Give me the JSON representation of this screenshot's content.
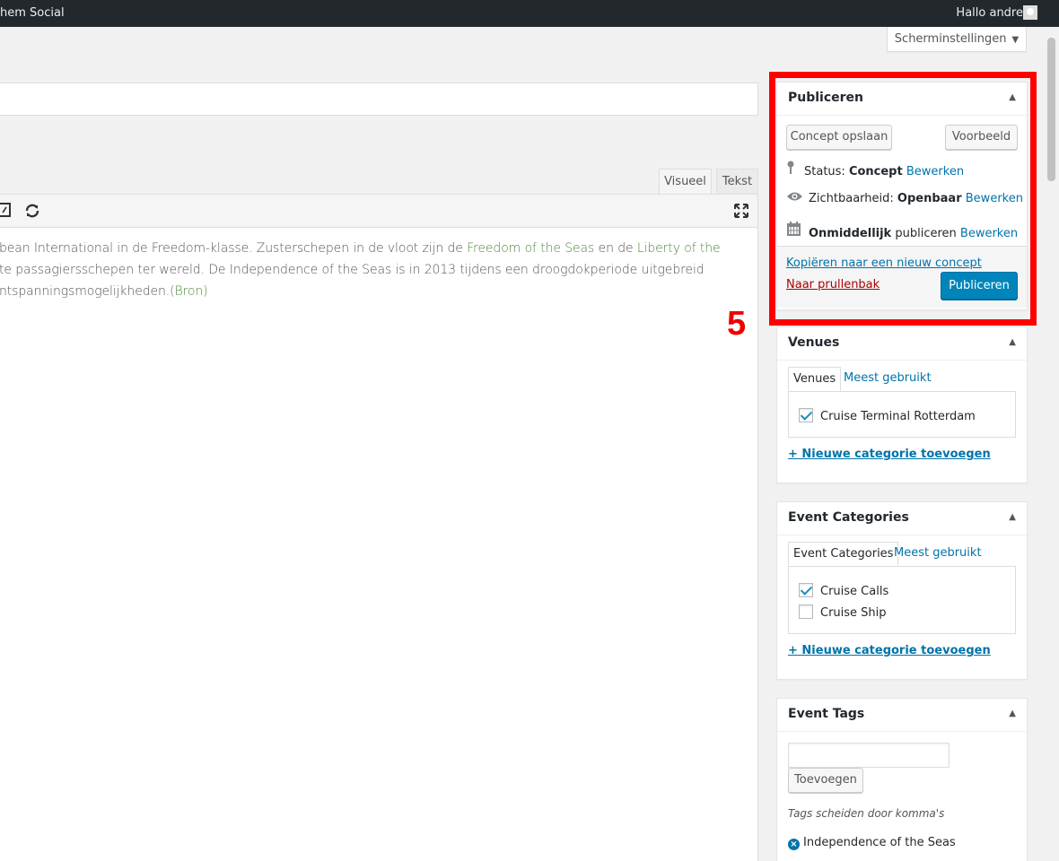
{
  "admin_bar": {
    "site_name": "hem Social",
    "greeting": "Hallo andre"
  },
  "screen_options": {
    "label": "Scherminstellingen",
    "arrow": "▼"
  },
  "editor": {
    "tabs": {
      "visual": "Visueel",
      "text": "Tekst"
    },
    "icons": [
      "code-icon",
      "refresh-icon",
      "fullscreen-icon"
    ],
    "content": {
      "line1_a": "bean International in de Freedom-klasse. Zusterschepen in de vloot zijn de ",
      "line1_link": "Freedom of the Seas",
      "line1_b": " en de ",
      "line1_link2": "Liberty of the",
      "line2": "te passagiersschepen ter wereld. De Independence of the Seas is in 2013 tijdens een droogdokperiode uitgebreid",
      "line3_a": "ntspanningsmogelijkheden.",
      "line3_link": "(Bron)"
    }
  },
  "annotation": {
    "step_number": "5",
    "highlight_color": "#ff0000"
  },
  "publish_box": {
    "title": "Publiceren",
    "save_draft": "Concept opslaan",
    "preview": "Voorbeeld",
    "status_label": "Status: ",
    "status_value": "Concept",
    "visibility_label": "Zichtbaarheid: ",
    "visibility_value": "Openbaar",
    "schedule_value": "Onmiddellijk",
    "schedule_label": " publiceren ",
    "edit": "Bewerken",
    "copy_draft": "Kopiëren naar een nieuw concept",
    "trash": "Naar prullenbak",
    "publish": "Publiceren"
  },
  "venues_box": {
    "title": "Venues",
    "tab_all": "Venues",
    "tab_popular": "Meest gebruikt",
    "items": [
      {
        "label": "Cruise Terminal Rotterdam",
        "checked": true
      }
    ],
    "add_new": "+ Nieuwe categorie toevoegen"
  },
  "event_categories_box": {
    "title": "Event Categories",
    "tab_all": "Event Categories",
    "tab_popular": "Meest gebruikt",
    "items": [
      {
        "label": "Cruise Calls",
        "checked": true
      },
      {
        "label": "Cruise Ship",
        "checked": false
      }
    ],
    "add_new": "+ Nieuwe categorie toevoegen"
  },
  "event_tags_box": {
    "title": "Event Tags",
    "add_button": "Toevoegen",
    "hint": "Tags scheiden door komma's",
    "tags": [
      "Independence of the Seas"
    ]
  },
  "colors": {
    "primary": "#0085ba",
    "link": "#0073aa",
    "trash": "#aa0000"
  }
}
